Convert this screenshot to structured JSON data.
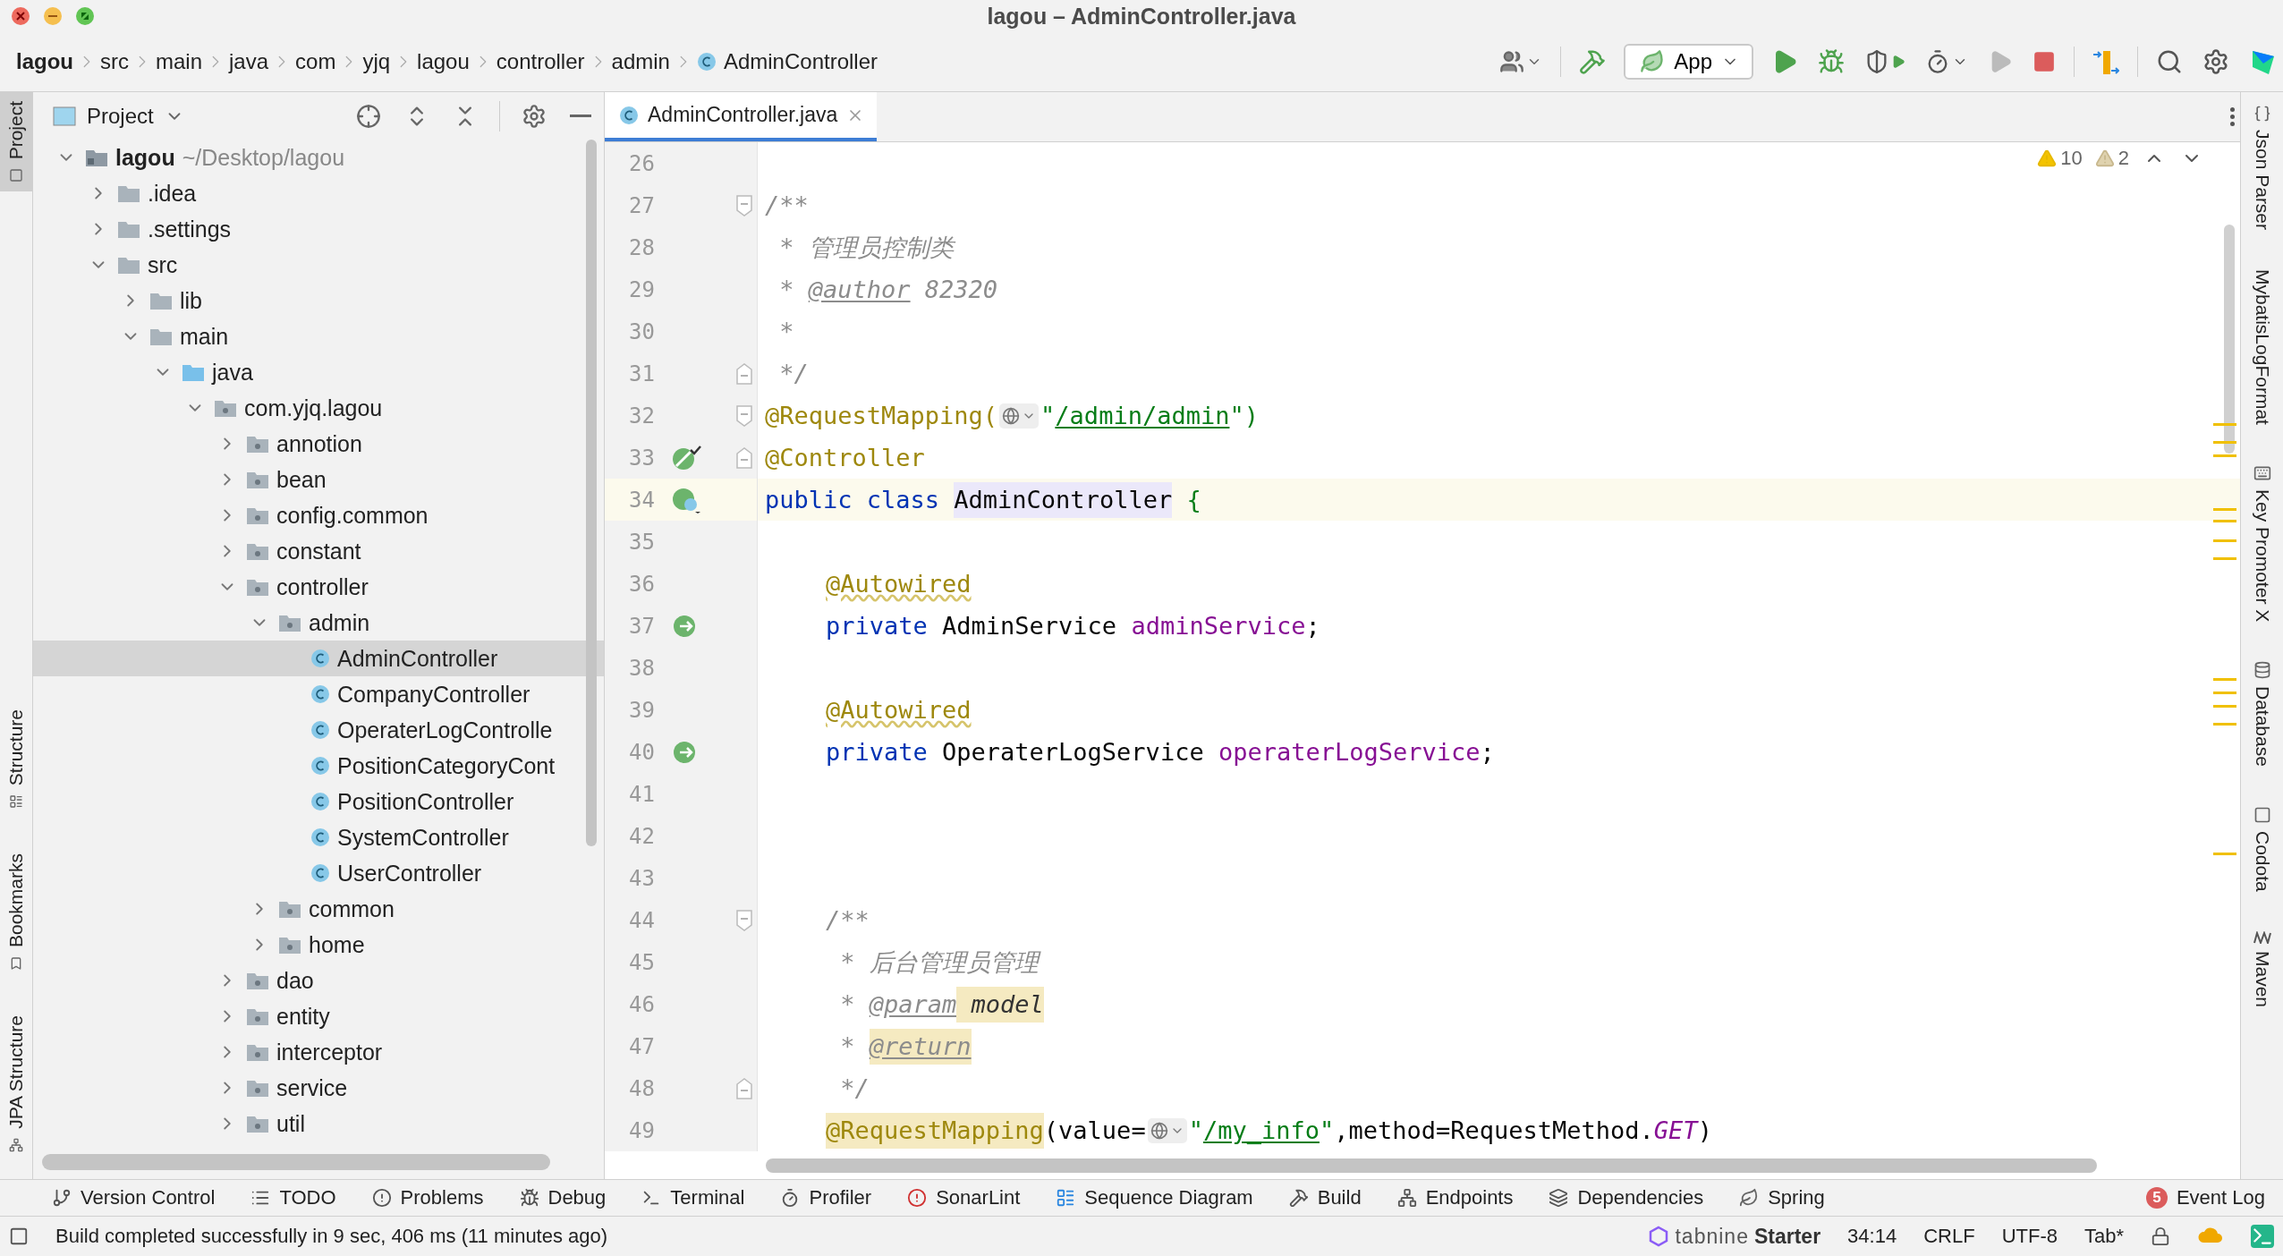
{
  "window": {
    "title": "lagou – AdminController.java"
  },
  "breadcrumbs": [
    {
      "label": "lagou",
      "kind": "project"
    },
    {
      "label": "src",
      "kind": "folder"
    },
    {
      "label": "main",
      "kind": "folder"
    },
    {
      "label": "java",
      "kind": "folder"
    },
    {
      "label": "com",
      "kind": "folder"
    },
    {
      "label": "yjq",
      "kind": "folder"
    },
    {
      "label": "lagou",
      "kind": "folder"
    },
    {
      "label": "controller",
      "kind": "folder"
    },
    {
      "label": "admin",
      "kind": "folder"
    },
    {
      "label": "AdminController",
      "kind": "class"
    }
  ],
  "toolbar": {
    "run_config": "App"
  },
  "left_strip": [
    {
      "label": "Project",
      "selected": true,
      "kind": "project"
    },
    {
      "label": "Structure",
      "selected": false,
      "kind": "structure"
    },
    {
      "label": "Bookmarks",
      "selected": false,
      "kind": "bookmark"
    },
    {
      "label": "JPA Structure",
      "selected": false,
      "kind": "jpa"
    }
  ],
  "project_panel": {
    "title": "Project",
    "tree": [
      {
        "label": "lagou",
        "path": "~/Desktop/lagou",
        "kind": "project",
        "expanded": true,
        "children": [
          {
            "label": ".idea",
            "kind": "folder",
            "expanded": false
          },
          {
            "label": ".settings",
            "kind": "folder",
            "expanded": false
          },
          {
            "label": "src",
            "kind": "folder",
            "expanded": true,
            "children": [
              {
                "label": "lib",
                "kind": "folder",
                "expanded": false
              },
              {
                "label": "main",
                "kind": "folder",
                "expanded": true,
                "children": [
                  {
                    "label": "java",
                    "kind": "source",
                    "expanded": true,
                    "children": [
                      {
                        "label": "com.yjq.lagou",
                        "kind": "package",
                        "expanded": true,
                        "children": [
                          {
                            "label": "annotion",
                            "kind": "package",
                            "expanded": false
                          },
                          {
                            "label": "bean",
                            "kind": "package",
                            "expanded": false
                          },
                          {
                            "label": "config.common",
                            "kind": "package",
                            "expanded": false
                          },
                          {
                            "label": "constant",
                            "kind": "package",
                            "expanded": false
                          },
                          {
                            "label": "controller",
                            "kind": "package",
                            "expanded": true,
                            "children": [
                              {
                                "label": "admin",
                                "kind": "package",
                                "expanded": true,
                                "children": [
                                  {
                                    "label": "AdminController",
                                    "kind": "class",
                                    "selected": true
                                  },
                                  {
                                    "label": "CompanyController",
                                    "kind": "class",
                                    "selected": false
                                  },
                                  {
                                    "label": "OperaterLogControlle",
                                    "kind": "class",
                                    "selected": false
                                  },
                                  {
                                    "label": "PositionCategoryCont",
                                    "kind": "class",
                                    "selected": false
                                  },
                                  {
                                    "label": "PositionController",
                                    "kind": "class",
                                    "selected": false
                                  },
                                  {
                                    "label": "SystemController",
                                    "kind": "class",
                                    "selected": false
                                  },
                                  {
                                    "label": "UserController",
                                    "kind": "class",
                                    "selected": false
                                  }
                                ]
                              },
                              {
                                "label": "common",
                                "kind": "package",
                                "expanded": false
                              },
                              {
                                "label": "home",
                                "kind": "package",
                                "expanded": false
                              }
                            ]
                          },
                          {
                            "label": "dao",
                            "kind": "package",
                            "expanded": false
                          },
                          {
                            "label": "entity",
                            "kind": "package",
                            "expanded": false
                          },
                          {
                            "label": "interceptor",
                            "kind": "package",
                            "expanded": false
                          },
                          {
                            "label": "service",
                            "kind": "package",
                            "expanded": false
                          },
                          {
                            "label": "util",
                            "kind": "package",
                            "expanded": false
                          }
                        ]
                      }
                    ]
                  }
                ]
              }
            ]
          }
        ]
      }
    ]
  },
  "editor": {
    "tabs": [
      {
        "label": "AdminController.java",
        "selected": true
      }
    ],
    "warnings": "10",
    "weak_warnings": "2",
    "lines": [
      {
        "number": "26"
      },
      {
        "number": "27",
        "fold": {
          "kind": "start"
        },
        "tokens": [
          {
            "text": "/**",
            "kind": "comment"
          }
        ]
      },
      {
        "number": "28",
        "tokens": [
          {
            "text": " * 管理员控制类",
            "kind": "comment"
          }
        ]
      },
      {
        "number": "29",
        "tokens": [
          {
            "text": " * ",
            "kind": "comment"
          },
          {
            "text": "@author",
            "kind": "doc_tag"
          },
          {
            "text": " 82320",
            "kind": "comment"
          }
        ]
      },
      {
        "number": "30",
        "tokens": [
          {
            "text": " *",
            "kind": "comment"
          }
        ]
      },
      {
        "number": "31",
        "fold": {
          "kind": "end"
        },
        "tokens": [
          {
            "text": " */",
            "kind": "comment"
          }
        ]
      },
      {
        "number": "32",
        "fold": {
          "kind": "start"
        },
        "tokens": [
          {
            "text": "@RequestMapping(",
            "kind": "annotation"
          },
          {
            "kind": "inlay"
          },
          {
            "text": "\"",
            "kind": "string"
          },
          {
            "text": "/admin/admin",
            "kind": "url"
          },
          {
            "text": "\")",
            "kind": "string"
          }
        ]
      },
      {
        "number": "33",
        "fold": {
          "kind": "end"
        },
        "gutter_icon": {
          "kind": "bean"
        },
        "tokens": [
          {
            "text": "@Controller",
            "kind": "annotation"
          }
        ]
      },
      {
        "number": "34",
        "current": true,
        "gutter_icon": {
          "kind": "bean_class"
        },
        "tokens": [
          {
            "text": "public class ",
            "kind": "keyword"
          },
          {
            "text": "AdminController",
            "kind": "plain",
            "highlighted": true
          },
          {
            "text": " {",
            "kind": "brace"
          }
        ]
      },
      {
        "number": "35"
      },
      {
        "number": "36",
        "indented": true,
        "tokens": [
          {
            "text": "@Autowired",
            "kind": "annotation",
            "warning": true
          }
        ]
      },
      {
        "number": "37",
        "indented": true,
        "gutter_icon": {
          "kind": "autowired"
        },
        "tokens": [
          {
            "text": "private ",
            "kind": "keyword"
          },
          {
            "text": "AdminService ",
            "kind": "plain"
          },
          {
            "text": "adminService",
            "kind": "field"
          },
          {
            "text": ";",
            "kind": "plain"
          }
        ]
      },
      {
        "number": "38"
      },
      {
        "number": "39",
        "indented": true,
        "tokens": [
          {
            "text": "@Autowired",
            "kind": "annotation",
            "warning": true
          }
        ]
      },
      {
        "number": "40",
        "indented": true,
        "gutter_icon": {
          "kind": "autowired"
        },
        "tokens": [
          {
            "text": "private ",
            "kind": "keyword"
          },
          {
            "text": "OperaterLogService ",
            "kind": "plain"
          },
          {
            "text": "operaterLogService",
            "kind": "field"
          },
          {
            "text": ";",
            "kind": "plain"
          }
        ]
      },
      {
        "number": "41"
      },
      {
        "number": "42"
      },
      {
        "number": "43"
      },
      {
        "number": "44",
        "indented": true,
        "fold": {
          "kind": "start"
        },
        "tokens": [
          {
            "text": "/**",
            "kind": "comment"
          }
        ]
      },
      {
        "number": "45",
        "indented": true,
        "tokens": [
          {
            "text": " * 后台管理员管理",
            "kind": "comment"
          }
        ]
      },
      {
        "number": "46",
        "indented": true,
        "tokens": [
          {
            "text": " * ",
            "kind": "comment"
          },
          {
            "text": "@param",
            "kind": "doc_tag"
          },
          {
            "text": " model",
            "kind": "param",
            "highlighted": true
          }
        ]
      },
      {
        "number": "47",
        "indented": true,
        "tokens": [
          {
            "text": " * ",
            "kind": "comment"
          },
          {
            "text": "@return",
            "kind": "doc_tag",
            "highlighted": true
          }
        ]
      },
      {
        "number": "48",
        "indented": true,
        "fold": {
          "kind": "end"
        },
        "tokens": [
          {
            "text": " */",
            "kind": "comment"
          }
        ]
      },
      {
        "number": "49",
        "indented": true,
        "tokens": [
          {
            "text": "@RequestMapping",
            "kind": "annotation",
            "highlighted": true
          },
          {
            "text": "(value=",
            "kind": "plain"
          },
          {
            "kind": "inlay"
          },
          {
            "text": "\"",
            "kind": "string"
          },
          {
            "text": "/my_info",
            "kind": "url"
          },
          {
            "text": "\"",
            "kind": "string"
          },
          {
            "text": ",method=RequestMethod.",
            "kind": "plain"
          },
          {
            "text": "GET",
            "kind": "constant"
          },
          {
            "text": ")",
            "kind": "plain"
          }
        ]
      }
    ]
  },
  "right_strip": [
    {
      "label": "Json Parser",
      "kind": "json"
    },
    {
      "label": "MybatisLogFormat",
      "kind": "none"
    },
    {
      "label": "Key Promoter X",
      "kind": "key"
    },
    {
      "label": "Database",
      "kind": "database"
    },
    {
      "label": "Codota",
      "kind": "codota"
    },
    {
      "label": "Maven",
      "kind": "maven"
    }
  ],
  "tool_windows": [
    {
      "label": "Version Control",
      "kind": "vcs"
    },
    {
      "label": "TODO",
      "kind": "todo"
    },
    {
      "label": "Problems",
      "kind": "problems"
    },
    {
      "label": "Debug",
      "kind": "debug"
    },
    {
      "label": "Terminal",
      "kind": "terminal"
    },
    {
      "label": "Profiler",
      "kind": "profiler"
    },
    {
      "label": "SonarLint",
      "kind": "sonar"
    },
    {
      "label": "Sequence Diagram",
      "kind": "sequence"
    },
    {
      "label": "Build",
      "kind": "build"
    },
    {
      "label": "Endpoints",
      "kind": "endpoints"
    },
    {
      "label": "Dependencies",
      "kind": "dependencies"
    },
    {
      "label": "Spring",
      "kind": "spring"
    }
  ],
  "event_log": {
    "label": "Event Log",
    "count": "5"
  },
  "status_bar": {
    "message": "Build completed successfully in 9 sec, 406 ms (11 minutes ago)",
    "plugin": {
      "name": "tabnine",
      "plan": "Starter"
    },
    "position": "34:14",
    "line_separator": "CRLF",
    "encoding": "UTF-8",
    "indent": "Tab*"
  }
}
